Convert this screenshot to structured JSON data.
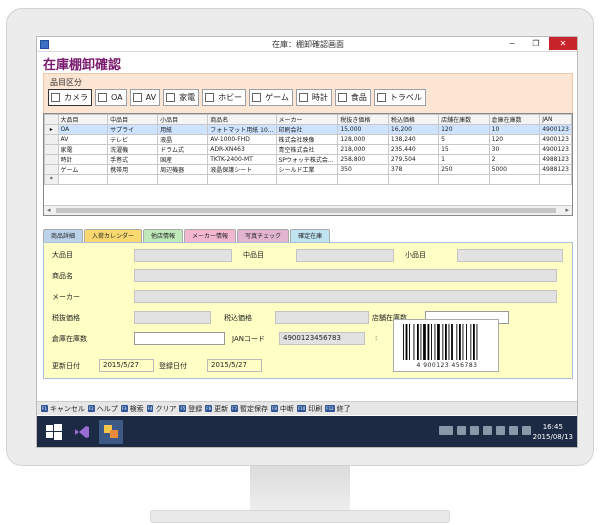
{
  "window": {
    "title": "在庫：棚卸確認画面",
    "minimize": "−",
    "restore": "❐",
    "close": "✕"
  },
  "page_title": "在庫棚卸確認",
  "category": {
    "label": "品目区分",
    "items": [
      {
        "label": "カメラ",
        "checked": false
      },
      {
        "label": "OA",
        "checked": false
      },
      {
        "label": "AV",
        "checked": false
      },
      {
        "label": "家電",
        "checked": false
      },
      {
        "label": "ホビー",
        "checked": false
      },
      {
        "label": "ゲーム",
        "checked": false
      },
      {
        "label": "時計",
        "checked": false
      },
      {
        "label": "食品",
        "checked": false
      },
      {
        "label": "トラベル",
        "checked": false
      }
    ]
  },
  "grid": {
    "columns": [
      "大品目",
      "中品目",
      "小品目",
      "商品名",
      "メーカー",
      "税抜き価格",
      "税込価格",
      "店舗在庫数",
      "倉庫在庫数",
      "JAN"
    ],
    "rows": [
      {
        "marker": "▸",
        "cells": [
          "OA",
          "サプライ",
          "用紙",
          "フォトマット用紙 10...",
          "印刷会社",
          "15,000",
          "16,200",
          "120",
          "10",
          "4900123"
        ]
      },
      {
        "marker": "",
        "cells": [
          "AV",
          "テレビ",
          "液晶",
          "AV-1000-FHD",
          "株式会社映像",
          "128,000",
          "138,240",
          "5",
          "120",
          "4900123"
        ]
      },
      {
        "marker": "",
        "cells": [
          "家電",
          "洗濯機",
          "ドラム式",
          "ADR-XN463",
          "青空株式会社",
          "218,000",
          "235,440",
          "15",
          "30",
          "4900123"
        ]
      },
      {
        "marker": "",
        "cells": [
          "時計",
          "手巻式",
          "国産",
          "TKTK-2400-MT",
          "SPウォッチ株式会...",
          "258,800",
          "279,504",
          "1",
          "2",
          "4988123"
        ]
      },
      {
        "marker": "",
        "cells": [
          "ゲーム",
          "携帯用",
          "周辺機器",
          "液晶保護シート",
          "シールド工業",
          "350",
          "378",
          "250",
          "5000",
          "4988123"
        ]
      },
      {
        "marker": "*",
        "cells": [
          "",
          "",
          "",
          "",
          "",
          "",
          "",
          "",
          "",
          ""
        ]
      }
    ],
    "scroll_left": "◂",
    "scroll_right": "▸"
  },
  "tabs": [
    "商品詳細",
    "入荷カレンダー",
    "他店情報",
    "メーカー情報",
    "写真チェック",
    "確定在庫"
  ],
  "detail": {
    "label_major": "大品目",
    "label_middle": "中品目",
    "label_minor": "小品目",
    "label_name": "商品名",
    "label_maker": "メーカー",
    "label_price_ex": "税抜価格",
    "label_price_in": "税込価格",
    "label_store_stock": "店舗在庫数",
    "label_warehouse_stock": "倉庫在庫数",
    "label_jan": "JANコード",
    "jan_value": "4900123456783",
    "colon": ":",
    "barcode_digits": "4 900123 456783",
    "label_updated": "更新日付",
    "updated_value": "2015/5/27",
    "label_registered": "登録日付",
    "registered_value": "2015/5/27"
  },
  "fkeys": [
    {
      "key": "F1",
      "label": "キャンセル"
    },
    {
      "key": "F2",
      "label": "ヘルプ"
    },
    {
      "key": "F3",
      "label": "検索"
    },
    {
      "key": "F4",
      "label": "クリア"
    },
    {
      "key": "F5",
      "label": "登録"
    },
    {
      "key": "F6",
      "label": "更新"
    },
    {
      "key": "F7",
      "label": "暫定保存"
    },
    {
      "key": "F8",
      "label": "中断"
    },
    {
      "key": "F10",
      "label": "印刷"
    },
    {
      "key": "F12",
      "label": "終了"
    }
  ],
  "taskbar": {
    "time": "16:45",
    "date": "2015/08/13"
  },
  "colors": {
    "title": "#7a1a6e",
    "category_bg": "#fde5d3",
    "detail_bg": "#ffffc5",
    "taskbar": "#1c2a44"
  }
}
